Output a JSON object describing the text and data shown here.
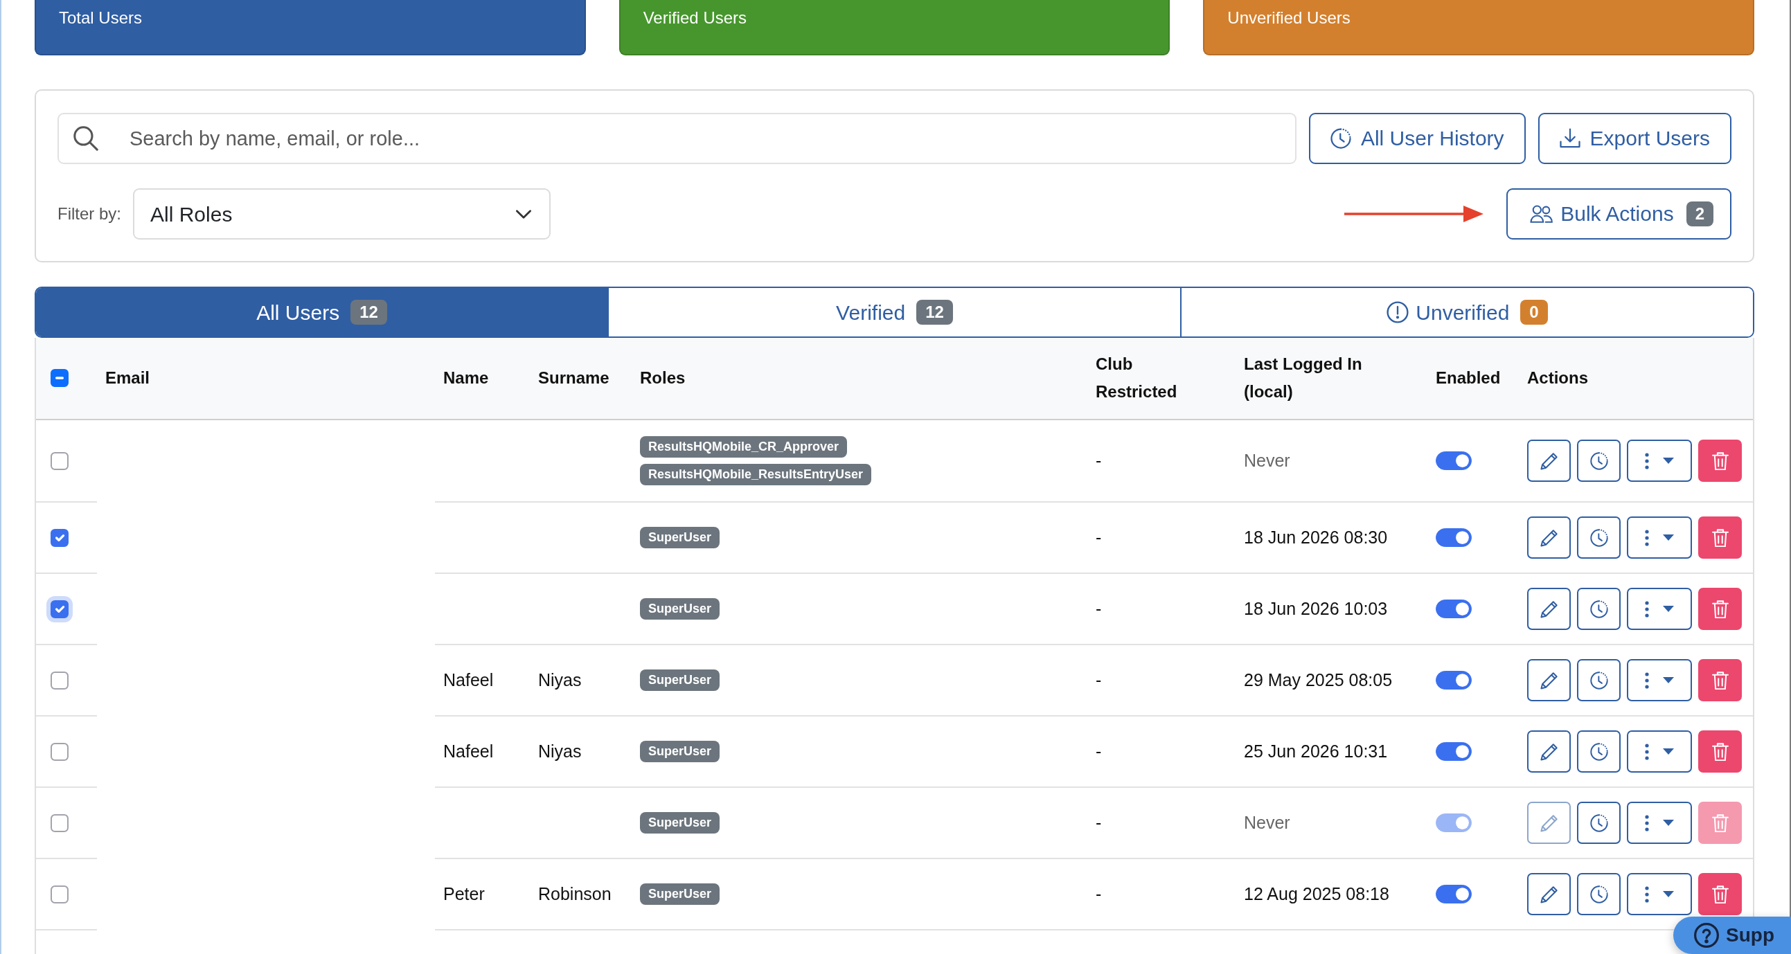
{
  "stat_cards": [
    {
      "title": "Total Users",
      "color": "#2f5ea3"
    },
    {
      "title": "Verified Users",
      "color": "#47962d"
    },
    {
      "title": "Unverified Users",
      "color": "#d3802e"
    }
  ],
  "filters": {
    "search": {
      "placeholder": "Search by name, email, or role..."
    },
    "history_button": {
      "label": "All User History"
    },
    "export_button": {
      "label": "Export Users"
    },
    "filter_label": "Filter by:",
    "role_select": {
      "value": "All Roles"
    },
    "bulk_actions": {
      "label": "Bulk Actions",
      "count": "2"
    }
  },
  "tabs": [
    {
      "label": "All Users",
      "count": "12",
      "selected": true,
      "kind": "plain",
      "color": "#6c757d"
    },
    {
      "label": "Verified",
      "count": "12",
      "selected": false,
      "kind": "plain",
      "color": "#6c757d"
    },
    {
      "label": "Unverified",
      "count": "0",
      "selected": false,
      "kind": "alert",
      "color": "#d3802e"
    }
  ],
  "table": {
    "select_all": {
      "indeterminate": true
    },
    "columns": [
      "Email",
      "Name",
      "Surname",
      "Roles",
      "Club Restricted",
      "Last Logged In (local)",
      "Enabled",
      "Actions"
    ],
    "rows": [
      {
        "selected": false,
        "focused": false,
        "roles": [
          "ResultsHQMobile_CR_Approver",
          "ResultsHQMobile_ResultsEntryUser"
        ],
        "club_restricted": "-",
        "last_login": "Never",
        "last_login_muted": true,
        "enabled": true,
        "disabled": false
      },
      {
        "selected": true,
        "focused": false,
        "roles": [
          "SuperUser"
        ],
        "club_restricted": "-",
        "last_login": "18 Jun 2026 08:30",
        "last_login_muted": false,
        "enabled": true,
        "disabled": false
      },
      {
        "selected": true,
        "focused": true,
        "roles": [
          "SuperUser"
        ],
        "club_restricted": "-",
        "last_login": "18 Jun 2026 10:03",
        "last_login_muted": false,
        "enabled": true,
        "disabled": false
      },
      {
        "selected": false,
        "focused": false,
        "name": "Nafeel",
        "surname": "Niyas",
        "roles": [
          "SuperUser"
        ],
        "club_restricted": "-",
        "last_login": "29 May 2025 08:05",
        "last_login_muted": false,
        "enabled": true,
        "disabled": false
      },
      {
        "selected": false,
        "focused": false,
        "name": "Nafeel",
        "surname": "Niyas",
        "roles": [
          "SuperUser"
        ],
        "club_restricted": "-",
        "last_login": "25 Jun 2026 10:31",
        "last_login_muted": false,
        "enabled": true,
        "disabled": false
      },
      {
        "selected": false,
        "focused": false,
        "roles": [
          "SuperUser"
        ],
        "club_restricted": "-",
        "last_login": "Never",
        "last_login_muted": true,
        "enabled": true,
        "disabled": true
      },
      {
        "selected": false,
        "focused": false,
        "name": "Peter",
        "surname": "Robinson",
        "roles": [
          "SuperUser"
        ],
        "club_restricted": "-",
        "last_login": "12 Aug 2025 08:18",
        "last_login_muted": false,
        "enabled": true,
        "disabled": false
      }
    ]
  },
  "support_button": {
    "label": "Supp"
  }
}
